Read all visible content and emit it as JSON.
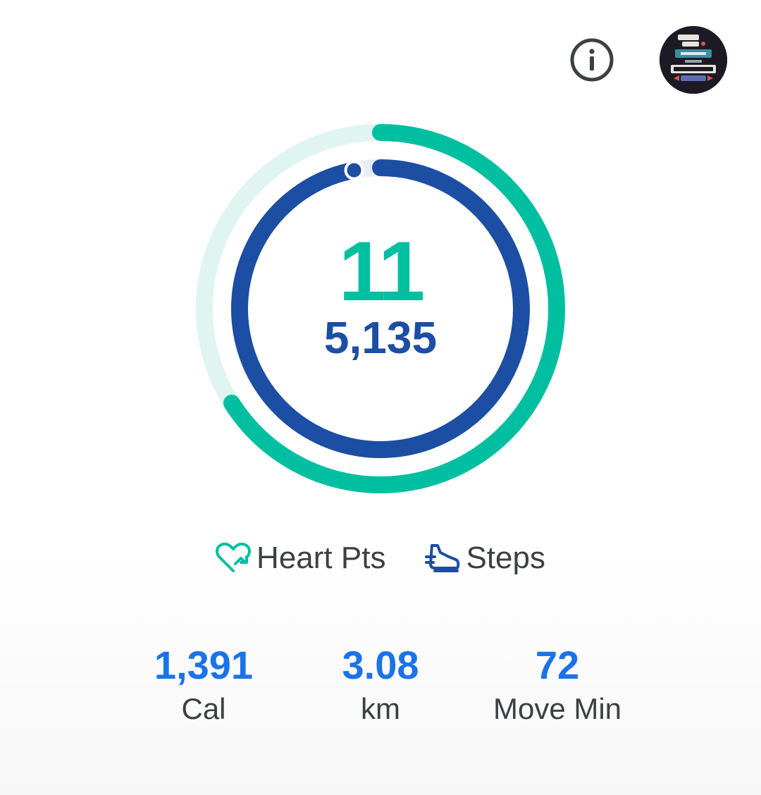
{
  "header": {
    "info_icon": "info-icon",
    "avatar_icon": "profile-avatar"
  },
  "rings": {
    "heart_points": "11",
    "steps": "5,135",
    "heart_points_progress": 0.66,
    "steps_progress": 0.97,
    "colors": {
      "heart": "#00bfa1",
      "heart_track": "#e0f5f1",
      "steps": "#1c4ea4"
    }
  },
  "legend": {
    "heart_pts_label": "Heart Pts",
    "heart_icon": "heart-points-icon",
    "steps_label": "Steps",
    "steps_icon": "steps-shoe-icon"
  },
  "stats": {
    "cal_value": "1,391",
    "cal_label": "Cal",
    "km_value": "3.08",
    "km_label": "km",
    "move_value": "72",
    "move_label": "Move Min",
    "value_color": "#1a73e8"
  }
}
